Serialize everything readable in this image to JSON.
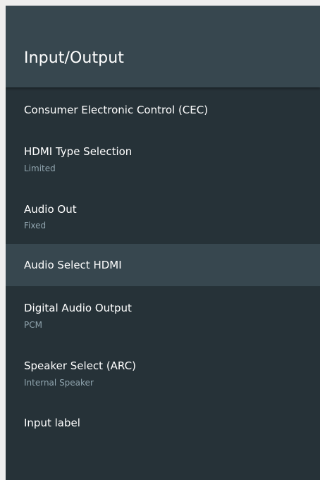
{
  "header": {
    "title": "Input/Output"
  },
  "menu": {
    "items": [
      {
        "title": "Consumer Electronic Control (CEC)",
        "subtitle": ""
      },
      {
        "title": "HDMI Type Selection",
        "subtitle": "Limited"
      },
      {
        "title": "Audio Out",
        "subtitle": "Fixed"
      },
      {
        "title": "Audio Select HDMI",
        "subtitle": ""
      },
      {
        "title": "Digital Audio Output",
        "subtitle": "PCM"
      },
      {
        "title": "Speaker Select (ARC)",
        "subtitle": "Internal Speaker"
      },
      {
        "title": "Input label",
        "subtitle": ""
      }
    ]
  },
  "colors": {
    "page_background": "#eeeeee",
    "panel_background": "#263238",
    "header_background": "#37474f",
    "selected_item_background": "#37474f",
    "title_text": "#ffffff",
    "subtitle_text": "#90a4ae"
  }
}
